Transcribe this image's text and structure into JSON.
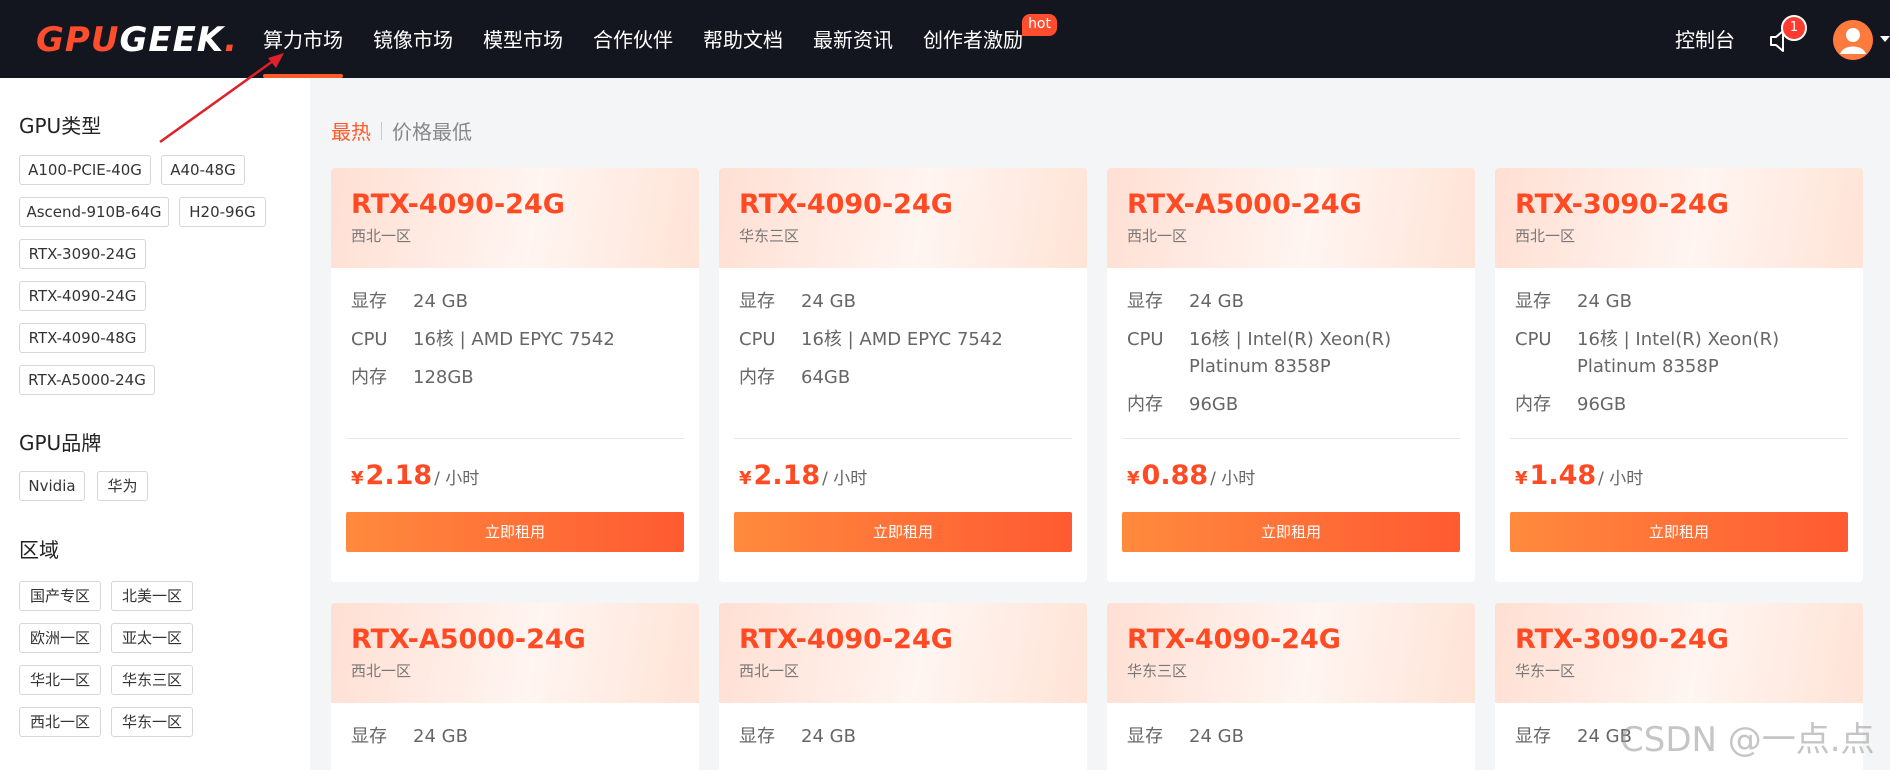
{
  "header": {
    "logo_part1": "GPU",
    "logo_part2": "GEEK",
    "logo_dot": ".",
    "nav": [
      {
        "label": "算力市场",
        "active": true
      },
      {
        "label": "镜像市场"
      },
      {
        "label": "模型市场"
      },
      {
        "label": "合作伙伴"
      },
      {
        "label": "帮助文档"
      },
      {
        "label": "最新资讯"
      },
      {
        "label": "创作者激励",
        "badge": "hot"
      }
    ],
    "console": "控制台",
    "notification_count": "1",
    "icons": {
      "bell": "bell-icon",
      "avatar": "avatar"
    }
  },
  "sidebar": {
    "gpu_type_title": "GPU类型",
    "gpu_types": [
      "A100-PCIE-40G",
      "A40-48G",
      "Ascend-910B-64G",
      "H20-96G",
      "RTX-3090-24G",
      "RTX-4090-24G",
      "RTX-4090-48G",
      "RTX-A5000-24G"
    ],
    "gpu_brand_title": "GPU品牌",
    "gpu_brands": [
      "Nvidia",
      "华为"
    ],
    "region_title": "区域",
    "regions": [
      "国产专区",
      "北美一区",
      "欧洲一区",
      "亚太一区",
      "华北一区",
      "华东三区",
      "西北一区",
      "华东一区"
    ]
  },
  "sort": {
    "hot": "最热",
    "price_low": "价格最低"
  },
  "labels": {
    "vram": "显存",
    "cpu": "CPU",
    "ram": "内存",
    "currency": "¥",
    "unit": "/ 小时",
    "rent": "立即租用"
  },
  "cards": [
    {
      "name": "RTX-4090-24G",
      "region": "西北一区",
      "vram": "24 GB",
      "cpu": "16核 | AMD EPYC 7542",
      "ram": "128GB",
      "price": "2.18"
    },
    {
      "name": "RTX-4090-24G",
      "region": "华东三区",
      "vram": "24 GB",
      "cpu": "16核 | AMD EPYC 7542",
      "ram": "64GB",
      "price": "2.18"
    },
    {
      "name": "RTX-A5000-24G",
      "region": "西北一区",
      "vram": "24 GB",
      "cpu": "16核 | Intel(R) Xeon(R) Platinum 8358P",
      "ram": "96GB",
      "price": "0.88"
    },
    {
      "name": "RTX-3090-24G",
      "region": "西北一区",
      "vram": "24 GB",
      "cpu": "16核 | Intel(R) Xeon(R) Platinum 8358P",
      "ram": "96GB",
      "price": "1.48"
    },
    {
      "name": "RTX-A5000-24G",
      "region": "西北一区",
      "vram": "24 GB"
    },
    {
      "name": "RTX-4090-24G",
      "region": "西北一区",
      "vram": "24 GB"
    },
    {
      "name": "RTX-4090-24G",
      "region": "华东三区",
      "vram": "24 GB"
    },
    {
      "name": "RTX-3090-24G",
      "region": "华东一区",
      "vram": "24 GB"
    }
  ],
  "watermark": "CSDN @一点.点",
  "colors": {
    "accent": "#ff4a24",
    "topbar": "#14161f",
    "button_start": "#ff8a3d",
    "button_end": "#ff5a32"
  }
}
